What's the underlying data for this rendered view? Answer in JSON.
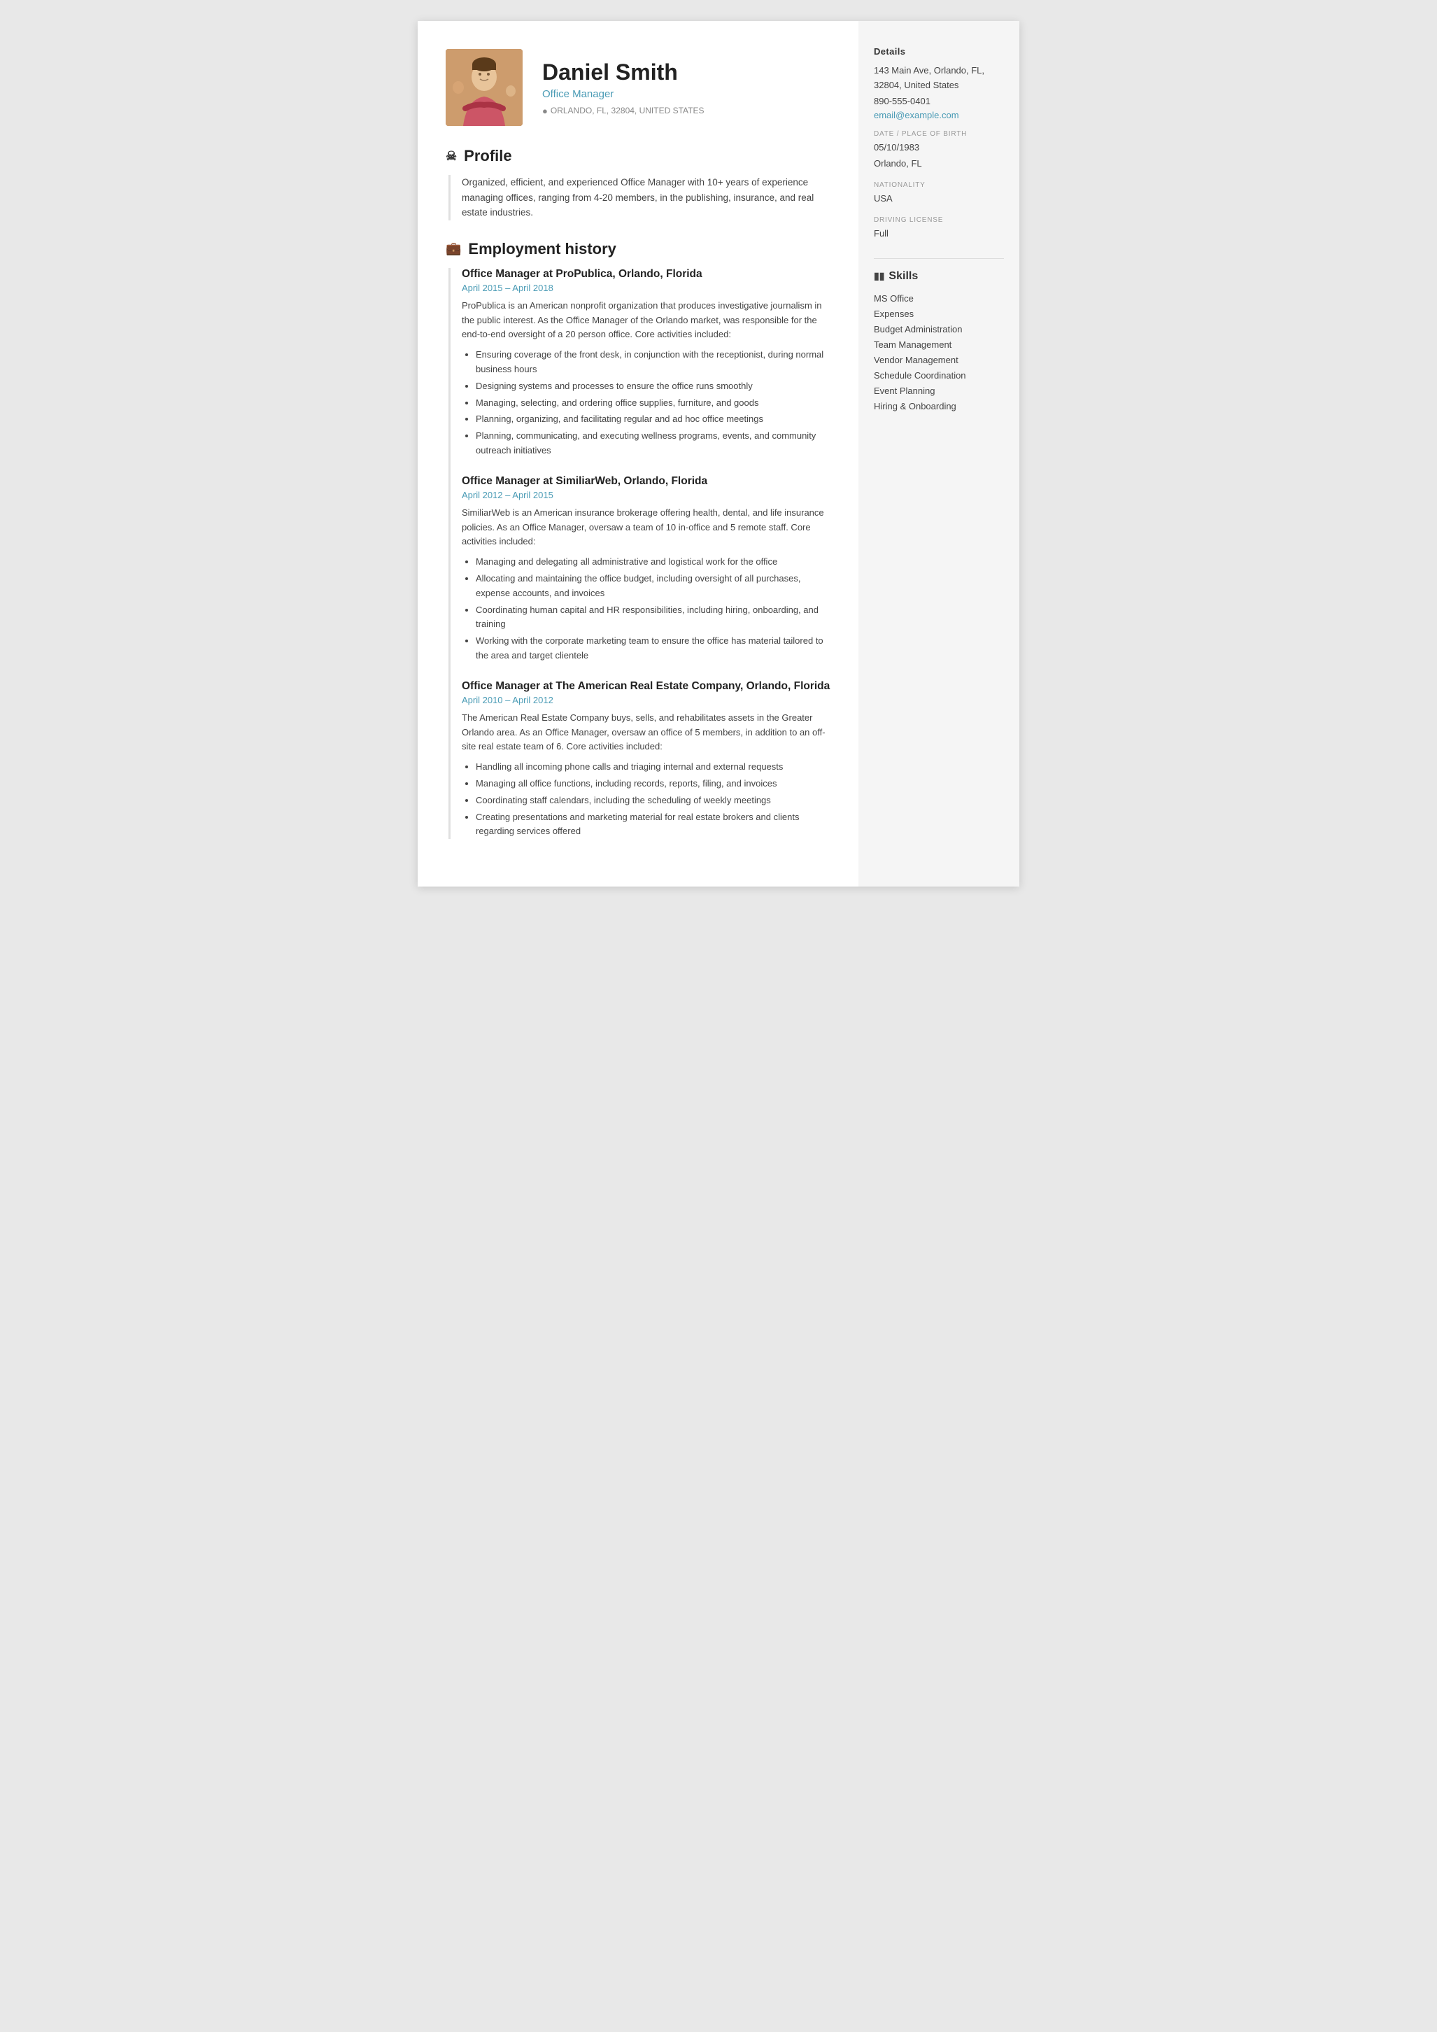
{
  "header": {
    "name": "Daniel Smith",
    "title": "Office Manager",
    "location": "ORLANDO, FL, 32804, UNITED STATES"
  },
  "profile": {
    "section_title": "Profile",
    "text": "Organized, efficient, and experienced Office Manager with 10+ years of experience managing offices, ranging from 4-20 members, in the publishing, insurance, and real estate industries."
  },
  "employment": {
    "section_title": "Employment history",
    "jobs": [
      {
        "title": "Office Manager at ProPublica, Orlando, Florida",
        "dates": "April 2015  –  April 2018",
        "description": "ProPublica is an American nonprofit organization that produces investigative journalism in the public interest. As the Office Manager of the Orlando market, was responsible for the end-to-end oversight of a 20 person office. Core activities included:",
        "bullets": [
          "Ensuring coverage of the front desk, in conjunction with the receptionist, during normal business hours",
          "Designing systems and processes to ensure the office runs smoothly",
          "Managing, selecting, and ordering office supplies, furniture, and goods",
          "Planning, organizing, and facilitating regular and ad hoc office meetings",
          "Planning, communicating, and executing wellness programs, events, and community outreach initiatives"
        ]
      },
      {
        "title": "Office Manager at SimiliarWeb, Orlando, Florida",
        "dates": "April 2012  –  April 2015",
        "description": "SimiliarWeb is an American insurance brokerage offering health, dental, and life insurance policies. As an Office Manager, oversaw a team of 10 in-office and 5 remote staff. Core activities included:",
        "bullets": [
          "Managing and delegating all administrative and logistical work for the office",
          "Allocating and maintaining the office budget, including oversight of all purchases, expense accounts, and invoices",
          "Coordinating human capital and HR responsibilities, including hiring, onboarding, and training",
          "Working with the corporate marketing team to ensure the office has material tailored to the area and target clientele"
        ]
      },
      {
        "title": "Office Manager at The American Real Estate Company, Orlando, Florida",
        "dates": "April 2010  –  April 2012",
        "description": "The American Real Estate Company buys, sells, and rehabilitates assets in the Greater Orlando area. As an Office Manager, oversaw an office of 5 members, in addition to an off-site real estate team of 6. Core activities included:",
        "bullets": [
          "Handling all incoming phone calls and triaging internal and external requests",
          "Managing all office functions, including records, reports, filing, and invoices",
          "Coordinating staff calendars, including the scheduling of weekly meetings",
          "Creating presentations and marketing material for real estate brokers and clients regarding services offered"
        ]
      }
    ]
  },
  "sidebar": {
    "details_title": "Details",
    "address": "143 Main Ave, Orlando, FL, 32804, United States",
    "phone": "890-555-0401",
    "email": "email@example.com",
    "dob_label": "DATE / PLACE OF BIRTH",
    "dob": "05/10/1983",
    "dob_place": "Orlando, FL",
    "nationality_label": "NATIONALITY",
    "nationality": "USA",
    "license_label": "DRIVING LICENSE",
    "license": "Full",
    "skills_title": "Skills",
    "skills": [
      "MS Office",
      "Expenses",
      "Budget Administration",
      "Team Management",
      "Vendor Management",
      "Schedule Coordination",
      "Event Planning",
      "Hiring & Onboarding"
    ]
  }
}
